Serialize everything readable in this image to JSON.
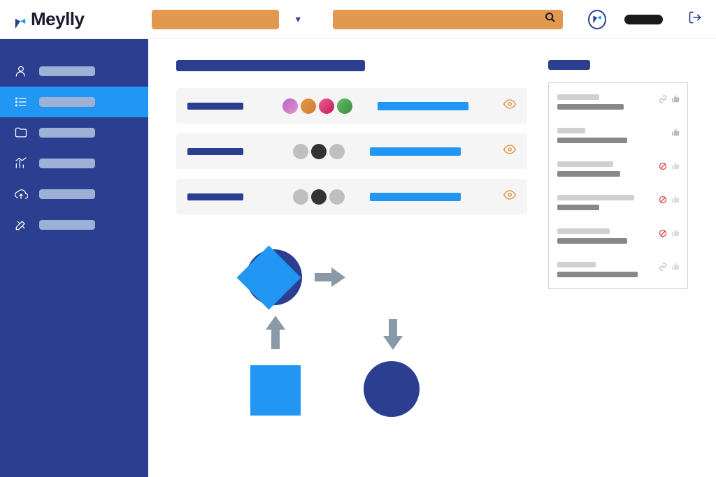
{
  "brand": {
    "name": "Meylly"
  },
  "header": {
    "dropdown_placeholder": "",
    "search_placeholder": ""
  },
  "sidebar": {
    "items": [
      {
        "label": "",
        "icon": "user-icon",
        "active": false
      },
      {
        "label": "",
        "icon": "list-icon",
        "active": true
      },
      {
        "label": "",
        "icon": "folder-icon",
        "active": false
      },
      {
        "label": "",
        "icon": "chart-icon",
        "active": false
      },
      {
        "label": "",
        "icon": "upload-cloud-icon",
        "active": false
      },
      {
        "label": "",
        "icon": "tools-icon",
        "active": false
      }
    ]
  },
  "main": {
    "title": "",
    "rows": [
      {
        "title": "",
        "avatar_style": "colored",
        "bar": "",
        "action": "view"
      },
      {
        "title": "",
        "avatar_style": "grey",
        "bar": "",
        "action": "view"
      },
      {
        "title": "",
        "avatar_style": "grey",
        "bar": "",
        "action": "view"
      }
    ]
  },
  "flowchart": {
    "nodes": [
      {
        "shape": "circle",
        "fill": "dark"
      },
      {
        "shape": "diamond",
        "fill": "light"
      },
      {
        "shape": "square",
        "fill": "light"
      },
      {
        "shape": "circle",
        "fill": "dark"
      }
    ],
    "edges": [
      {
        "from": 0,
        "to": 1,
        "dir": "right"
      },
      {
        "from": 1,
        "to": 3,
        "dir": "down"
      },
      {
        "from": 2,
        "to": 0,
        "dir": "up"
      }
    ]
  },
  "side_panel": {
    "title": "",
    "items": [
      {
        "line1_w": 60,
        "line2_w": 95,
        "status": "link-thumb"
      },
      {
        "line1_w": 40,
        "line2_w": 100,
        "status": "thumb"
      },
      {
        "line1_w": 80,
        "line2_w": 90,
        "status": "block-thumb"
      },
      {
        "line1_w": 110,
        "line2_w": 60,
        "status": "block-thumb"
      },
      {
        "line1_w": 75,
        "line2_w": 100,
        "status": "block-thumb"
      },
      {
        "line1_w": 55,
        "line2_w": 115,
        "status": "link-thumb"
      }
    ]
  },
  "colors": {
    "primary": "#2c3e8f",
    "accent": "#2196f3",
    "orange": "#e3984f"
  }
}
